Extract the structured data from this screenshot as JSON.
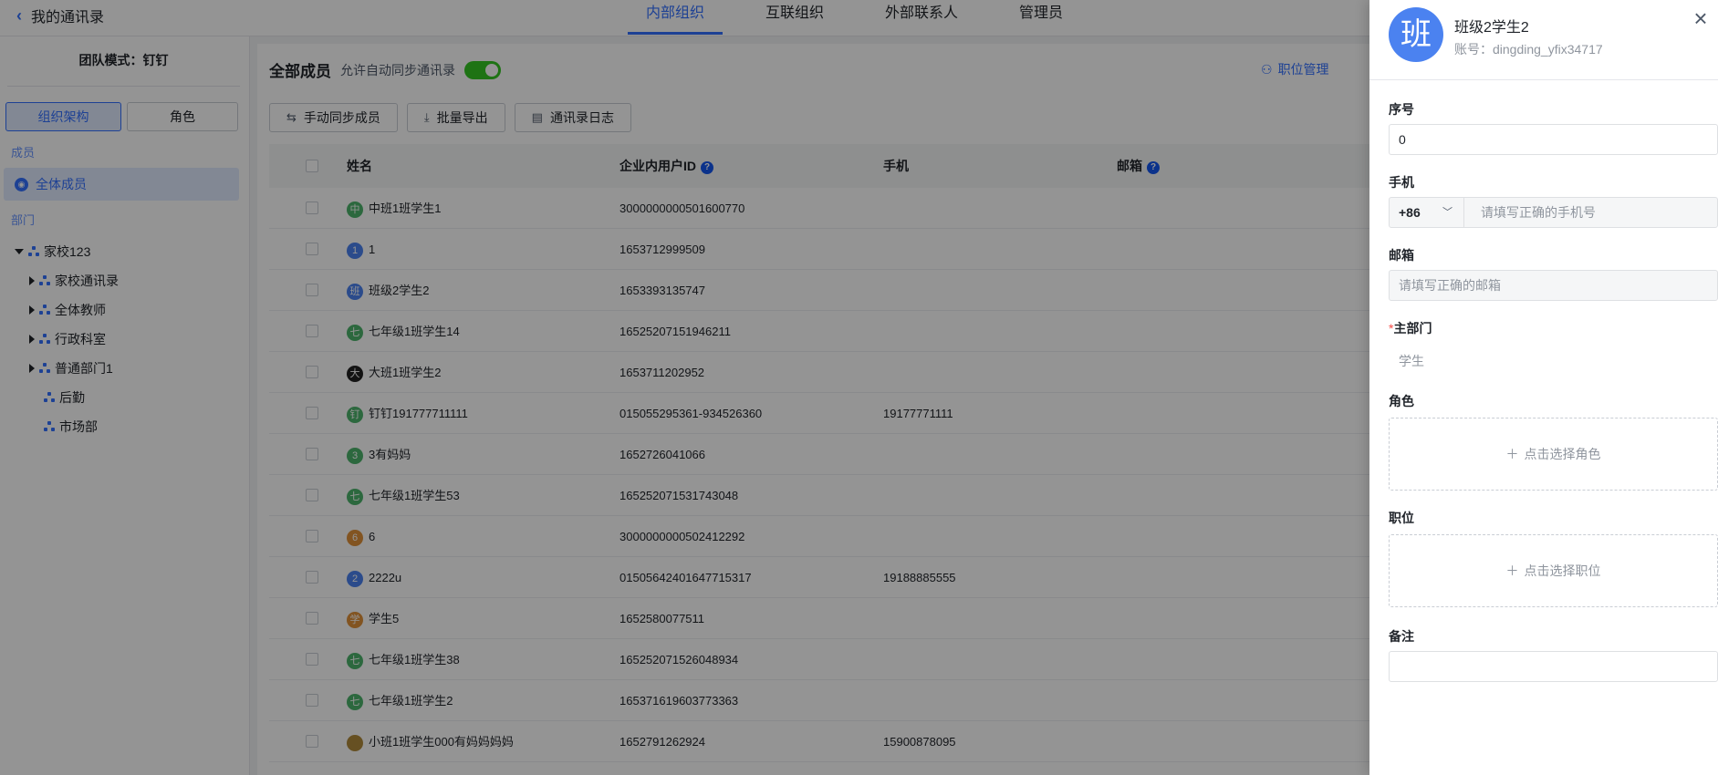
{
  "topbar": {
    "back_label": "我的通讯录",
    "tabs": [
      {
        "label": "内部组织",
        "active": true
      },
      {
        "label": "互联组织",
        "active": false
      },
      {
        "label": "外部联系人",
        "active": false
      },
      {
        "label": "管理员",
        "active": false
      }
    ]
  },
  "sidebar": {
    "mode": "团队模式：钉钉",
    "seg_org": "组织架构",
    "seg_role": "角色",
    "members_label": "成员",
    "all_members": "全体成员",
    "dept_label": "部门",
    "root": "家校123",
    "depts": [
      "家校通讯录",
      "全体教师",
      "行政科室",
      "普通部门1",
      "后勤",
      "市场部"
    ]
  },
  "main": {
    "title": "全部成员",
    "sync_label": "允许自动同步通讯录",
    "position_mgmt": "职位管理",
    "buttons": {
      "sync": "手动同步成员",
      "export": "批量导出",
      "log": "通讯录日志"
    },
    "columns": {
      "name": "姓名",
      "uid": "企业内用户ID",
      "phone": "手机",
      "email": "邮箱"
    },
    "rows": [
      {
        "avatar": "中",
        "color": "#4db46b",
        "name": "中班1班学生1",
        "uid": "3000000000501600770",
        "phone": ""
      },
      {
        "avatar": "1",
        "color": "#4b82f0",
        "name": "1",
        "uid": "1653712999509",
        "phone": ""
      },
      {
        "avatar": "班",
        "color": "#4b82f0",
        "name": "班级2学生2",
        "uid": "1653393135747",
        "phone": ""
      },
      {
        "avatar": "七",
        "color": "#4db46b",
        "name": "七年级1班学生14",
        "uid": "16525207151946211",
        "phone": ""
      },
      {
        "avatar": "大",
        "color": "#222222",
        "name": "大班1班学生2",
        "uid": "1653711202952",
        "phone": ""
      },
      {
        "avatar": "钉",
        "color": "#4db46b",
        "name": "钉钉191777711111",
        "uid": "015055295361-934526360",
        "phone": "19177771111"
      },
      {
        "avatar": "3",
        "color": "#4db46b",
        "name": "3有妈妈",
        "uid": "1652726041066",
        "phone": ""
      },
      {
        "avatar": "七",
        "color": "#4db46b",
        "name": "七年级1班学生53",
        "uid": "165252071531743048",
        "phone": ""
      },
      {
        "avatar": "6",
        "color": "#e0913a",
        "name": "6",
        "uid": "3000000000502412292",
        "phone": ""
      },
      {
        "avatar": "2",
        "color": "#4b82f0",
        "name": "2222u",
        "uid": "01505642401647715317",
        "phone": "19188885555"
      },
      {
        "avatar": "学",
        "color": "#e0913a",
        "name": "学生5",
        "uid": "1652580077511",
        "phone": ""
      },
      {
        "avatar": "七",
        "color": "#4db46b",
        "name": "七年级1班学生38",
        "uid": "165252071526048934",
        "phone": ""
      },
      {
        "avatar": "七",
        "color": "#4db46b",
        "name": "七年级1班学生2",
        "uid": "165371619603773363",
        "phone": ""
      },
      {
        "avatar": "",
        "color": "#b08b3c",
        "name": "小班1班学生000有妈妈妈妈",
        "uid": "1652791262924",
        "phone": "15900878095"
      }
    ]
  },
  "drawer": {
    "avatar_char": "班",
    "name": "班级2学生2",
    "account": "账号：dingding_yfix34717",
    "order_label": "序号",
    "order_value": "0",
    "phone_label": "手机",
    "phone_prefix": "+86",
    "phone_placeholder": "请填写正确的手机号",
    "email_label": "邮箱",
    "email_placeholder": "请填写正确的邮箱",
    "dept_label": "主部门",
    "dept_value": "学生",
    "role_label": "角色",
    "role_action": "点击选择角色",
    "position_label": "职位",
    "position_action": "点击选择职位",
    "note_label": "备注",
    "note_value": ""
  }
}
